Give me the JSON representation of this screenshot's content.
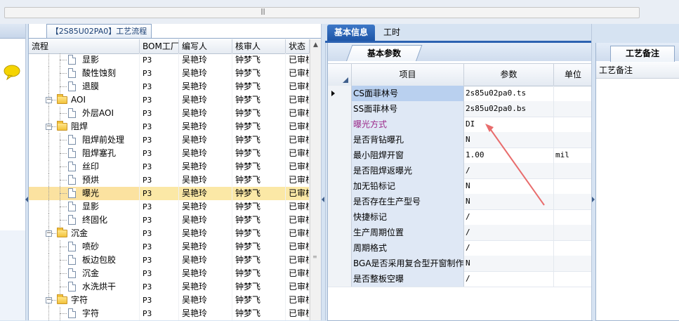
{
  "toolbar": {
    "scroll_grip": "|||"
  },
  "tree": {
    "tab_label": "【2S85U02PA0】工艺流程",
    "columns": [
      "流程",
      "BOM工厂",
      "编写人",
      "核审人",
      "状态"
    ],
    "rows": [
      {
        "name": "显影",
        "level": 2,
        "type": "doc",
        "bom": "P3",
        "writer": "吴艳玲",
        "checker": "钟梦飞",
        "status": "已审核"
      },
      {
        "name": "酸性蚀刻",
        "level": 2,
        "type": "doc",
        "bom": "P3",
        "writer": "吴艳玲",
        "checker": "钟梦飞",
        "status": "已审核"
      },
      {
        "name": "退膜",
        "level": 2,
        "type": "doc",
        "bom": "P3",
        "writer": "吴艳玲",
        "checker": "钟梦飞",
        "status": "已审核"
      },
      {
        "name": "AOI",
        "level": 1,
        "type": "folder",
        "bom": "P3",
        "writer": "吴艳玲",
        "checker": "钟梦飞",
        "status": "已审核"
      },
      {
        "name": "外层AOI",
        "level": 2,
        "type": "doc",
        "bom": "P3",
        "writer": "吴艳玲",
        "checker": "钟梦飞",
        "status": "已审核"
      },
      {
        "name": "阻焊",
        "level": 1,
        "type": "folder",
        "bom": "P3",
        "writer": "吴艳玲",
        "checker": "钟梦飞",
        "status": "已审核"
      },
      {
        "name": "阻焊前处理",
        "level": 2,
        "type": "doc",
        "bom": "P3",
        "writer": "吴艳玲",
        "checker": "钟梦飞",
        "status": "已审核"
      },
      {
        "name": "阻焊塞孔",
        "level": 2,
        "type": "doc",
        "bom": "P3",
        "writer": "吴艳玲",
        "checker": "钟梦飞",
        "status": "已审核"
      },
      {
        "name": "丝印",
        "level": 2,
        "type": "doc",
        "bom": "P3",
        "writer": "吴艳玲",
        "checker": "钟梦飞",
        "status": "已审核"
      },
      {
        "name": "预烘",
        "level": 2,
        "type": "doc",
        "bom": "P3",
        "writer": "吴艳玲",
        "checker": "钟梦飞",
        "status": "已审核"
      },
      {
        "name": "曝光",
        "level": 2,
        "type": "doc",
        "bom": "P3",
        "writer": "吴艳玲",
        "checker": "钟梦飞",
        "status": "已审核",
        "selected": true
      },
      {
        "name": "显影",
        "level": 2,
        "type": "doc",
        "bom": "P3",
        "writer": "吴艳玲",
        "checker": "钟梦飞",
        "status": "已审核"
      },
      {
        "name": "终固化",
        "level": 2,
        "type": "doc",
        "bom": "P3",
        "writer": "吴艳玲",
        "checker": "钟梦飞",
        "status": "已审核"
      },
      {
        "name": "沉金",
        "level": 1,
        "type": "folder",
        "bom": "P3",
        "writer": "吴艳玲",
        "checker": "钟梦飞",
        "status": "已审核"
      },
      {
        "name": "喷砂",
        "level": 2,
        "type": "doc",
        "bom": "P3",
        "writer": "吴艳玲",
        "checker": "钟梦飞",
        "status": "已审核"
      },
      {
        "name": "板边包胶",
        "level": 2,
        "type": "doc",
        "bom": "P3",
        "writer": "吴艳玲",
        "checker": "钟梦飞",
        "status": "已审核"
      },
      {
        "name": "沉金",
        "level": 2,
        "type": "doc",
        "bom": "P3",
        "writer": "吴艳玲",
        "checker": "钟梦飞",
        "status": "已审核"
      },
      {
        "name": "水洗烘干",
        "level": 2,
        "type": "doc",
        "bom": "P3",
        "writer": "吴艳玲",
        "checker": "钟梦飞",
        "status": "已审核"
      },
      {
        "name": "字符",
        "level": 1,
        "type": "folder",
        "bom": "P3",
        "writer": "吴艳玲",
        "checker": "钟梦飞",
        "status": "已审核"
      },
      {
        "name": "字符",
        "level": 2,
        "type": "doc",
        "bom": "P3",
        "writer": "吴艳玲",
        "checker": "钟梦飞",
        "status": "已审核"
      }
    ]
  },
  "info_tabs": {
    "active": "基本信息",
    "other": "工时"
  },
  "params": {
    "subtab": "基本参数",
    "columns": {
      "item": "项目",
      "value": "参数",
      "unit": "单位"
    },
    "rows": [
      {
        "item": "CS面菲林号",
        "value": "2s85u02pa0.ts",
        "unit": "",
        "current": true
      },
      {
        "item": "SS面菲林号",
        "value": "2s85u02pa0.bs",
        "unit": ""
      },
      {
        "item": "曝光方式",
        "value": "DI",
        "unit": "",
        "highlight": true
      },
      {
        "item": "是否背钻曝孔",
        "value": "N",
        "unit": ""
      },
      {
        "item": "最小阻焊开窗",
        "value": "1.00",
        "unit": "mil"
      },
      {
        "item": "是否阻焊返曝光",
        "value": "/",
        "unit": ""
      },
      {
        "item": "加无铅标记",
        "value": "N",
        "unit": ""
      },
      {
        "item": "是否存在生产型号",
        "value": "N",
        "unit": ""
      },
      {
        "item": "快捷标记",
        "value": "/",
        "unit": ""
      },
      {
        "item": "生产周期位置",
        "value": "/",
        "unit": ""
      },
      {
        "item": "周期格式",
        "value": "/",
        "unit": ""
      },
      {
        "item": "BGA是否采用复合型开窗制作",
        "value": "N",
        "unit": ""
      },
      {
        "item": "是否整板空曝",
        "value": "/",
        "unit": ""
      }
    ]
  },
  "remark": {
    "tab": "工艺备注",
    "column": "工艺备注"
  },
  "colors": {
    "accent": "#1e56a8",
    "selected_row": "#fbe8a6",
    "highlight_text": "#9b2a8a",
    "arrow": "#e86c6c"
  }
}
